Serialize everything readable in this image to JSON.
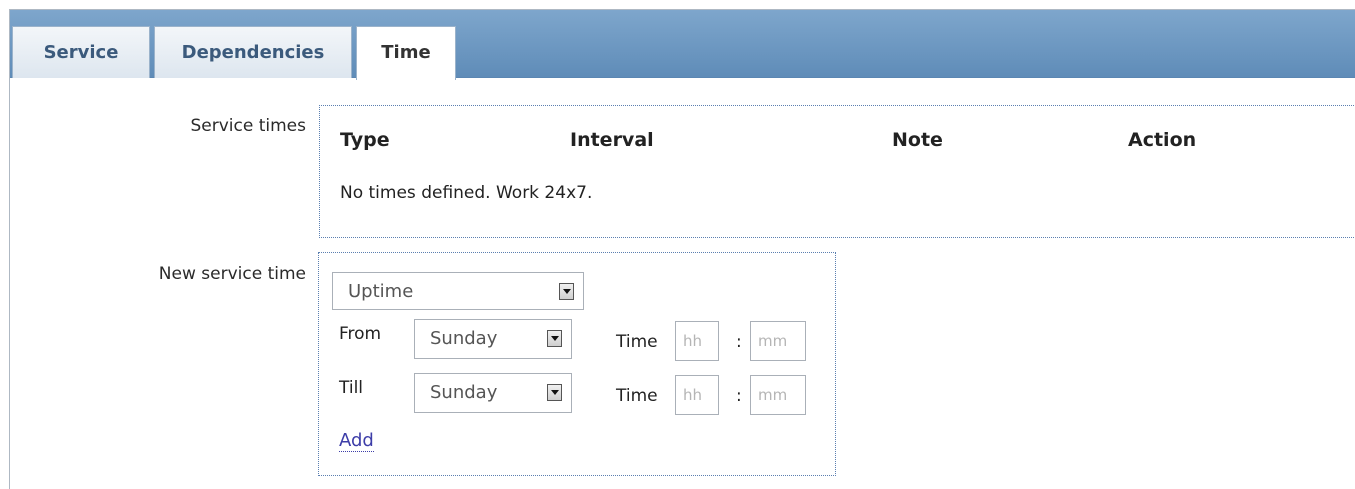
{
  "tabs": {
    "service": "Service",
    "dependencies": "Dependencies",
    "time": "Time"
  },
  "service_times": {
    "label": "Service times",
    "columns": {
      "type": "Type",
      "interval": "Interval",
      "note": "Note",
      "action": "Action"
    },
    "empty_message": "No times defined. Work 24x7."
  },
  "new_service_time": {
    "label": "New service time",
    "type_value": "Uptime",
    "from_label": "From",
    "till_label": "Till",
    "from_day": "Sunday",
    "till_day": "Sunday",
    "time_label": "Time",
    "hours_placeholder": "hh",
    "minutes_placeholder": "mm",
    "separator": ":",
    "add_label": "Add"
  },
  "colors": {
    "tab_bar": "#6f9bc6",
    "link": "#3d3da8",
    "dotted_border": "#5b7fb0"
  }
}
